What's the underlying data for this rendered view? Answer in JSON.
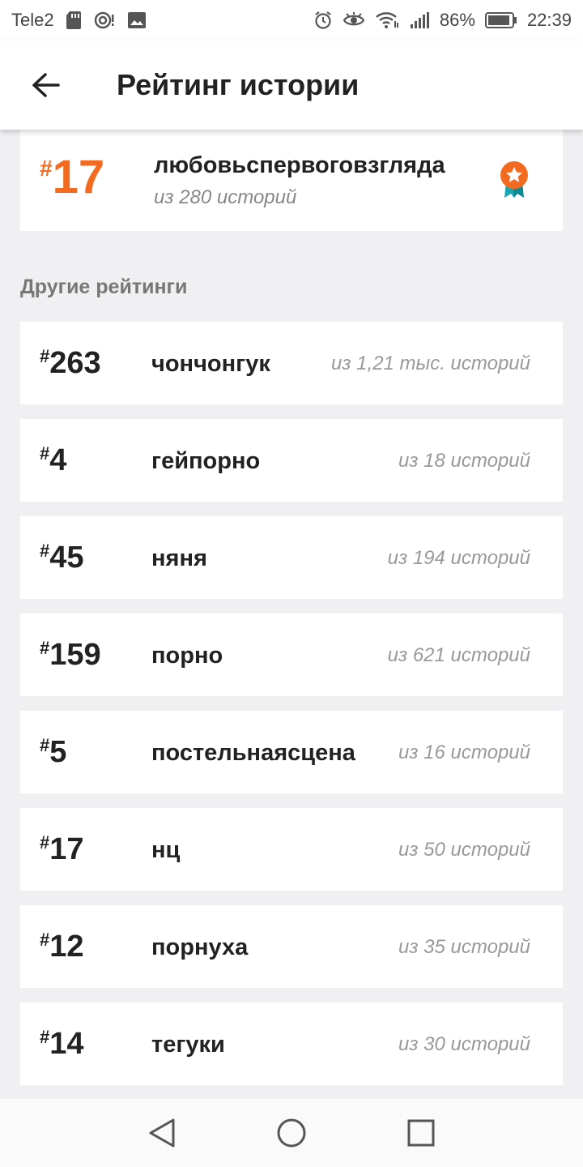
{
  "status_bar": {
    "carrier": "Tele2",
    "battery": "86%",
    "time": "22:39",
    "icons": [
      "sd-card-icon",
      "hotspot-icon",
      "image-icon",
      "alarm-icon",
      "eye-icon",
      "wifi-icon",
      "signal-icon",
      "battery-icon"
    ]
  },
  "app_bar": {
    "title": "Рейтинг истории",
    "back_icon": "back-arrow-icon"
  },
  "main_rank": {
    "hash": "#",
    "rank": "17",
    "tag": "любовьспервоговзгляда",
    "count": "из 280 историй",
    "badge_icon": "award-ribbon-icon",
    "accent_color": "#f26b21"
  },
  "other": {
    "title": "Другие рейтинги",
    "items": [
      {
        "hash": "#",
        "rank": "263",
        "tag": "чончонгук",
        "count": "из 1,21 тыс. историй"
      },
      {
        "hash": "#",
        "rank": "4",
        "tag": "гейпорно",
        "count": "из 18 историй"
      },
      {
        "hash": "#",
        "rank": "45",
        "tag": "няня",
        "count": "из 194 историй"
      },
      {
        "hash": "#",
        "rank": "159",
        "tag": "порно",
        "count": "из 621 историй"
      },
      {
        "hash": "#",
        "rank": "5",
        "tag": "постельнаясцена",
        "count": "из 16 историй"
      },
      {
        "hash": "#",
        "rank": "17",
        "tag": "нц",
        "count": "из 50 историй"
      },
      {
        "hash": "#",
        "rank": "12",
        "tag": "порнуха",
        "count": "из 35 историй"
      },
      {
        "hash": "#",
        "rank": "14",
        "tag": "тегуки",
        "count": "из 30 историй"
      }
    ]
  },
  "nav_bar": {
    "icons": [
      "nav-back-icon",
      "nav-home-icon",
      "nav-recents-icon"
    ]
  }
}
